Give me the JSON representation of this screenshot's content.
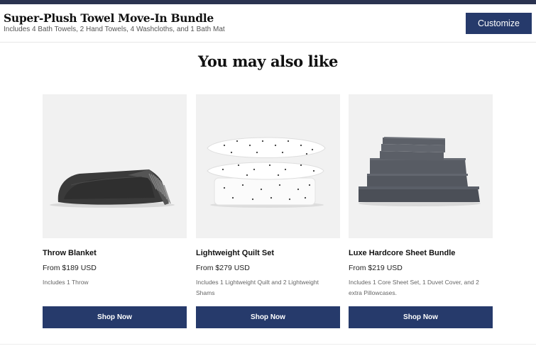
{
  "sticky_bar": {
    "title": "Super-Plush Towel Move-In Bundle",
    "subtitle": "Includes 4 Bath Towels, 2 Hand Towels, 4 Washcloths, and 1 Bath Mat",
    "customize_label": "Customize"
  },
  "section": {
    "title": "You may also like"
  },
  "products": [
    {
      "name": "Throw Blanket",
      "price": "From $189 USD",
      "description": "Includes 1 Throw",
      "button_label": "Shop Now",
      "image": "throw-blanket-image"
    },
    {
      "name": "Lightweight Quilt Set",
      "price": "From $279 USD",
      "description": "Includes 1 Lightweight Quilt and 2 Lightweight Shams",
      "button_label": "Shop Now",
      "image": "quilt-set-image"
    },
    {
      "name": "Luxe Hardcore Sheet Bundle",
      "price": "From $219 USD",
      "description": "Includes 1 Core Sheet Set, 1 Duvet Cover, and 2 extra Pillowcases.",
      "button_label": "Shop Now",
      "image": "sheet-bundle-image"
    }
  ],
  "colors": {
    "brand_navy": "#263a6b",
    "image_background": "#f1f1f1"
  }
}
